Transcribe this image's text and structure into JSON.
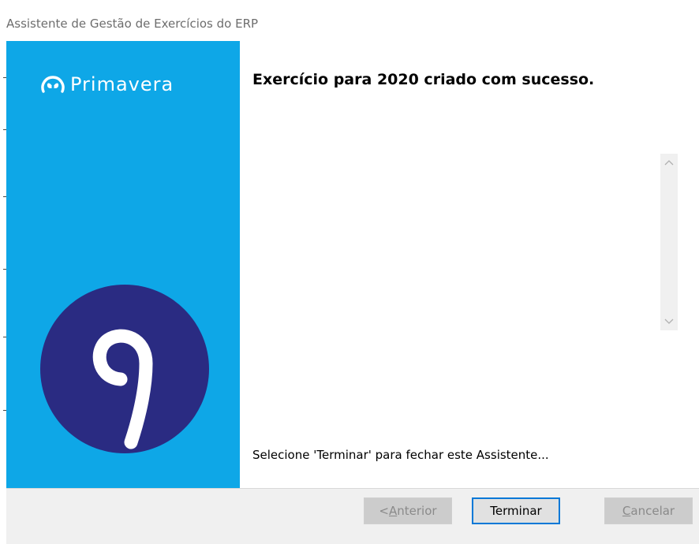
{
  "window": {
    "title": "Assistente de Gestão de Exercícios do ERP"
  },
  "sidebar": {
    "logo_text": "Primavera",
    "brand_color": "#0ea7e7",
    "circle_color": "#2a2b82"
  },
  "content": {
    "heading": "Exercício para 2020 criado com sucesso.",
    "footer_text": "Selecione 'Terminar' para fechar este Assistente..."
  },
  "buttons": {
    "anterior_prefix": "< ",
    "anterior_mnemonic": "A",
    "anterior_rest": "nterior",
    "terminar": "Terminar",
    "cancelar_mnemonic": "C",
    "cancelar_rest": "ancelar"
  },
  "icons": {
    "scroll_up": "chevron-up-icon",
    "scroll_down": "chevron-down-icon",
    "logo": "primavera-butterfly-icon",
    "brand_mark": "primavera-nine-icon"
  }
}
